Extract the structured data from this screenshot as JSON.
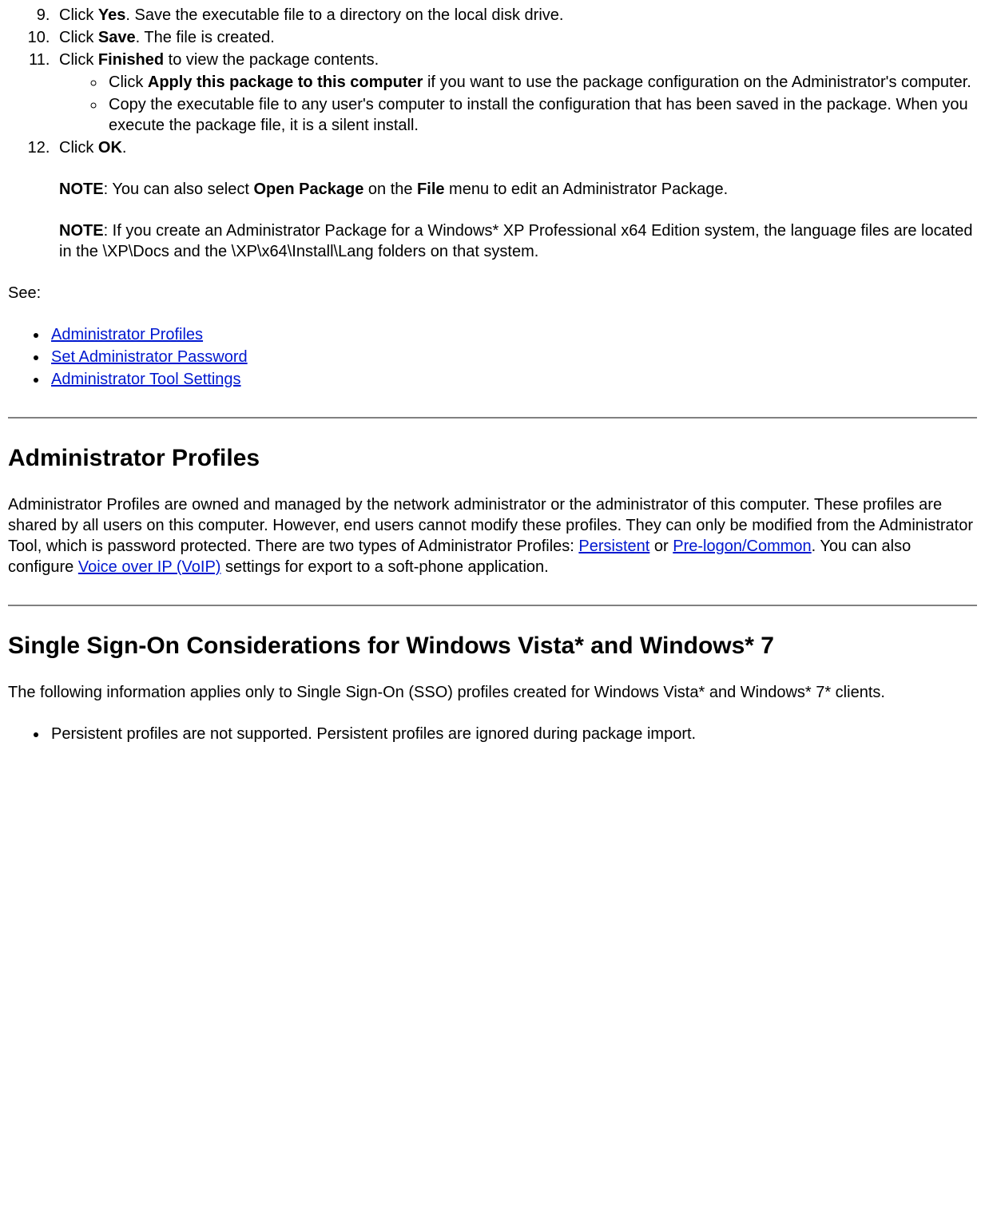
{
  "steps": {
    "s9": {
      "pre": "Click ",
      "b": "Yes",
      "post": ". Save the executable file to a directory on the local disk drive."
    },
    "s10": {
      "pre": "Click ",
      "b": "Save",
      "post": ". The file is created."
    },
    "s11": {
      "pre": "Click ",
      "b": "Finished",
      "post": " to view the package contents."
    },
    "s11a": {
      "pre": "Click ",
      "b": "Apply this package to this computer",
      "post": " if you want to use the package configuration on the Administrator's computer."
    },
    "s11b": "Copy the executable file to any user's computer to install the configuration that has been saved in the package. When you execute the package file, it is a silent install.",
    "s12": {
      "pre": "Click ",
      "b": "OK",
      "post": "."
    },
    "note1": {
      "n": "NOTE",
      "t1": ": You can also select ",
      "b1": "Open Package",
      "t2": " on the ",
      "b2": "File",
      "t3": " menu to edit an Administrator Package."
    },
    "note2": {
      "n": "NOTE",
      "t": ": If you create an Administrator Package for a Windows* XP Professional x64 Edition system, the language files are located in the \\XP\\Docs and the \\XP\\x64\\Install\\Lang folders on that system."
    }
  },
  "see": {
    "label": "See:",
    "links": {
      "l1": "Administrator Profiles",
      "l2": "Set Administrator Password",
      "l3": "Administrator Tool Settings"
    }
  },
  "sec1": {
    "heading": "Administrator Profiles",
    "p1a": "Administrator Profiles are owned and managed by the network administrator or the administrator of this computer. These profiles are shared by all users on this computer. However, end users cannot modify these profiles. They can only be modified from the Administrator Tool, which is password protected. There are two types of Administrator Profiles: ",
    "link1": "Persistent",
    "p1b": " or ",
    "link2": "Pre-logon/Common",
    "p1c": ". You can also configure ",
    "link3": "Voice over IP (VoIP)",
    "p1d": " settings for export to a soft-phone application."
  },
  "sec2": {
    "heading": "Single Sign-On Considerations for Windows Vista* and Windows* 7",
    "p": "The following information applies only to Single Sign-On (SSO) profiles created for Windows Vista* and Windows* 7* clients.",
    "b1": "Persistent profiles are not supported. Persistent profiles are ignored during package import."
  }
}
